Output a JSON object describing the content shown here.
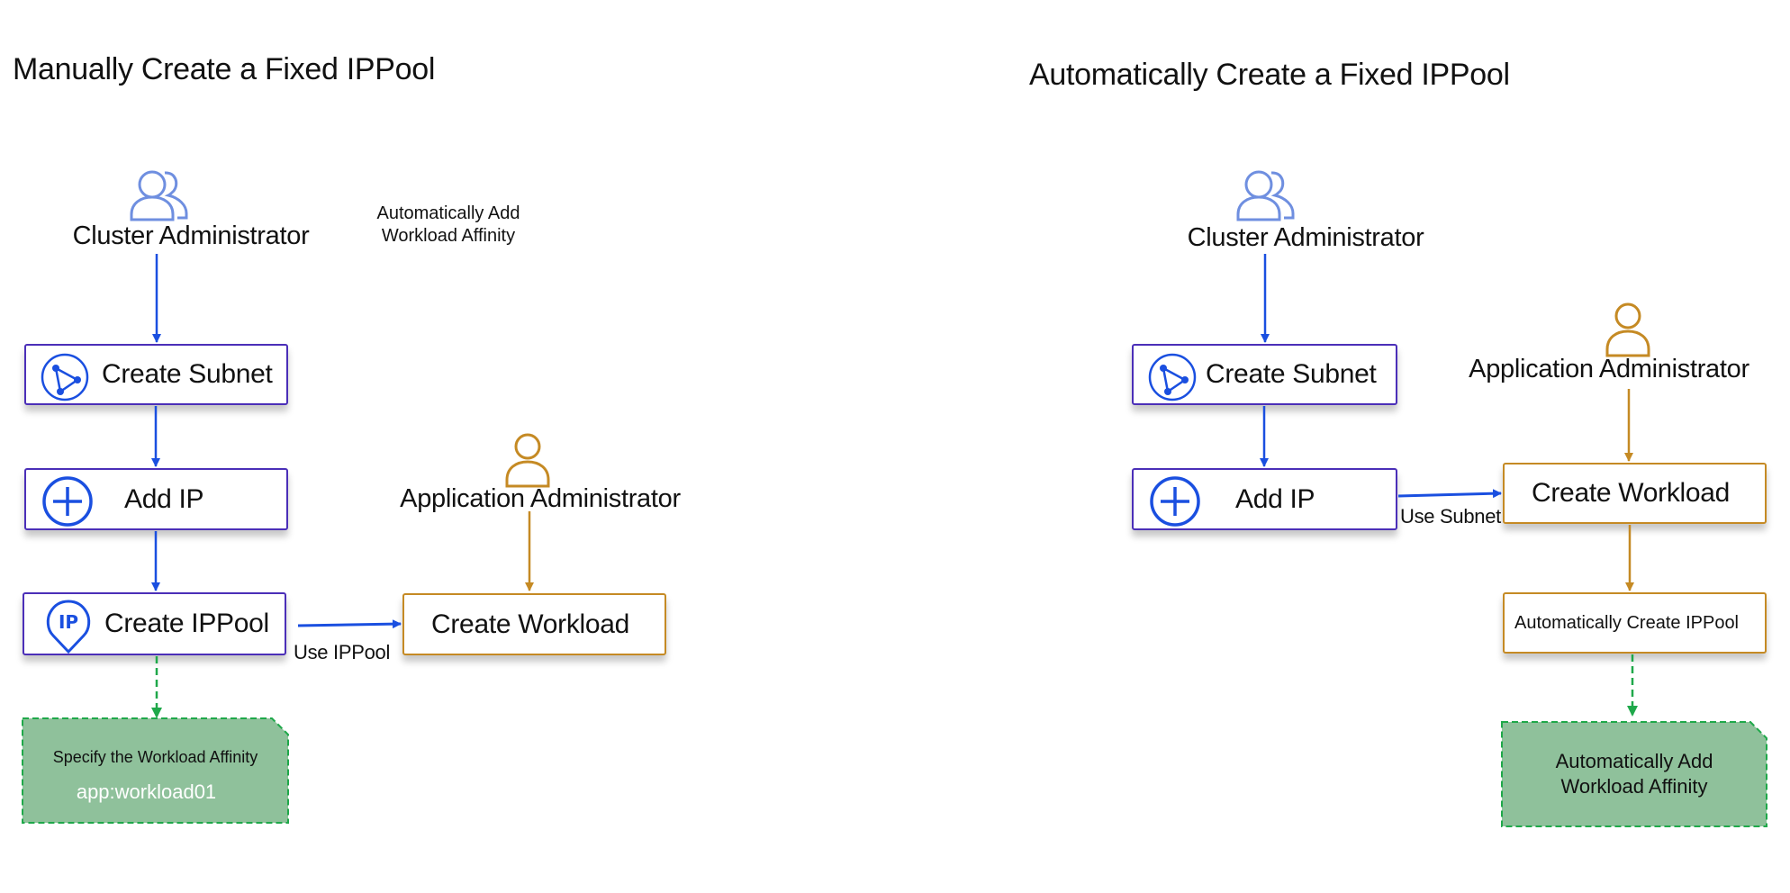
{
  "colors": {
    "blue": "#1a4fe0",
    "box_border_blue": "#4b2fb8",
    "gold": "#c58a24",
    "green_line": "#1fa84a",
    "green_fill": "#8fc19b",
    "cluster_icon": "#6f8fe0"
  },
  "left": {
    "title": "Manually Create a Fixed IPPool",
    "cluster_admin": {
      "label": "Cluster Administrator",
      "icon": "users-icon"
    },
    "floating_note": {
      "line1": "Automatically Add",
      "line2": "Workload Affinity"
    },
    "steps": [
      {
        "label": "Create Subnet",
        "icon": "subnet-icon"
      },
      {
        "label": "Add IP",
        "icon": "plus-circle-icon"
      },
      {
        "label": "Create IPPool",
        "icon": "ip-pin-icon"
      }
    ],
    "app_admin": {
      "label": "Application Administrator",
      "icon": "user-icon"
    },
    "workload": {
      "label": "Create Workload"
    },
    "edge_label": "Use IPPool",
    "affinity_note": {
      "line1": "Specify the Workload Affinity",
      "line2": "app:workload01"
    }
  },
  "right": {
    "title": "Automatically Create a Fixed IPPool",
    "cluster_admin": {
      "label": "Cluster Administrator",
      "icon": "users-icon"
    },
    "steps": [
      {
        "label": "Create Subnet",
        "icon": "subnet-icon"
      },
      {
        "label": "Add IP",
        "icon": "plus-circle-icon"
      }
    ],
    "app_admin": {
      "label": "Application Administrator",
      "icon": "user-icon"
    },
    "workload": {
      "label": "Create Workload"
    },
    "auto_ippool": {
      "label": "Automatically Create IPPool"
    },
    "edge_label": "Use Subnet",
    "affinity_note": {
      "line1": "Automatically Add",
      "line2": "Workload Affinity"
    }
  }
}
